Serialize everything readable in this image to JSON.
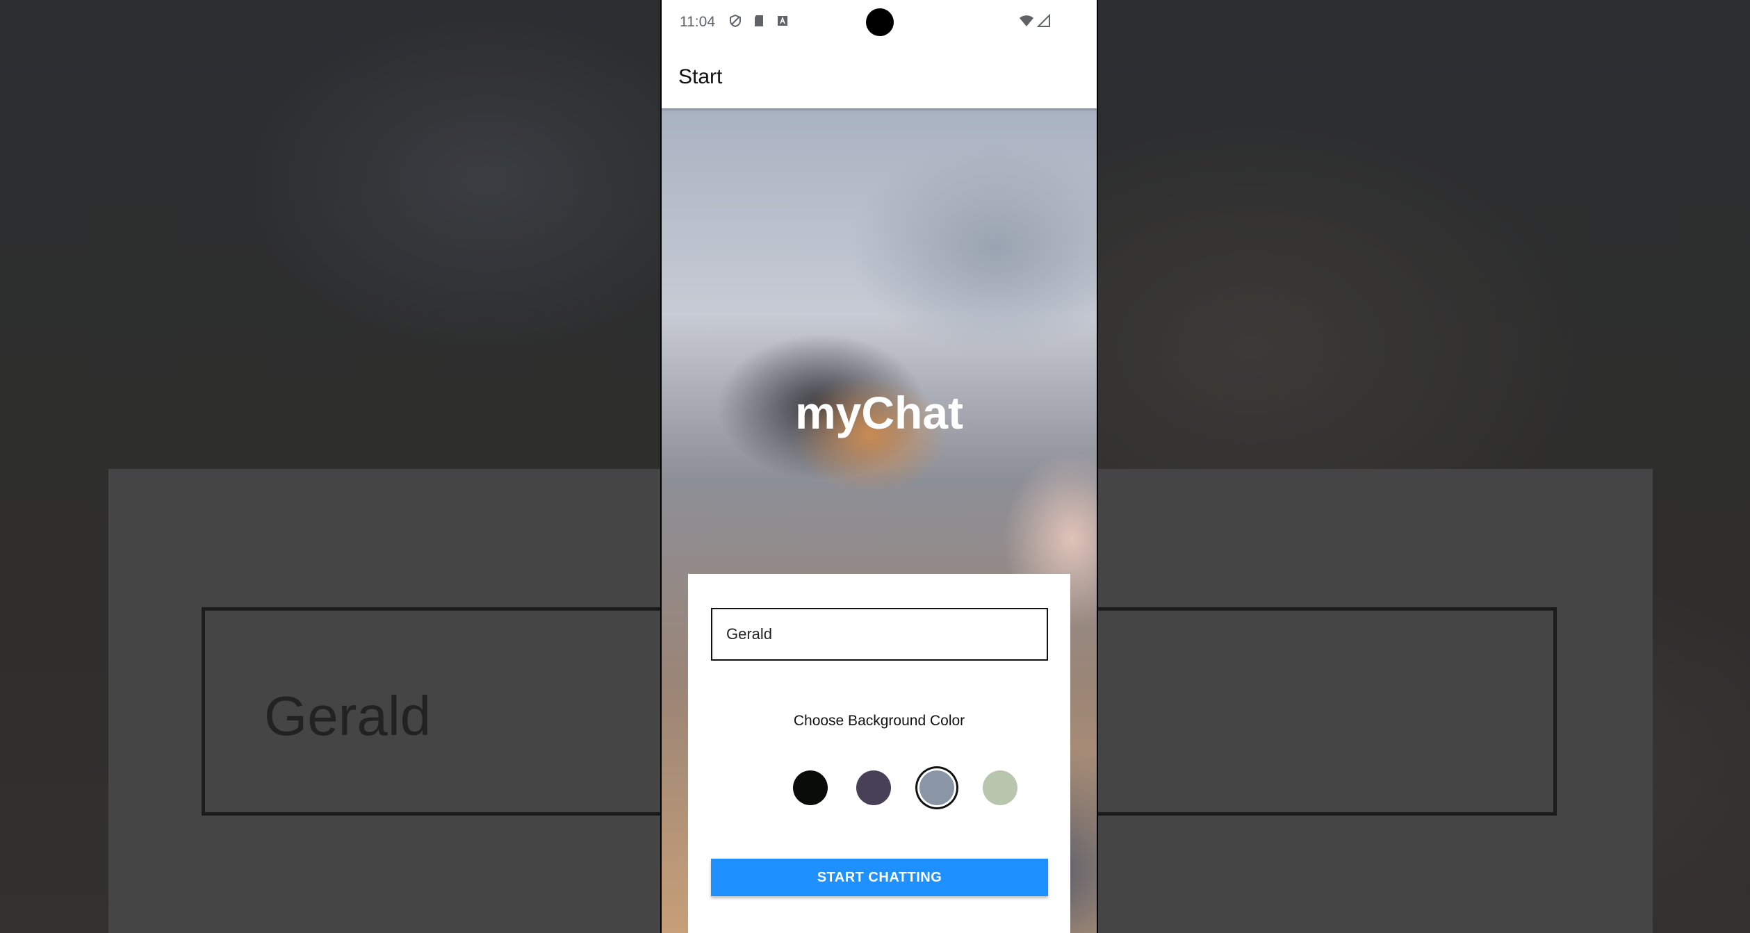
{
  "status_bar": {
    "time": "11:04",
    "icons": [
      "shield-icon",
      "sd-card-icon",
      "text-a-icon"
    ],
    "right_icons": [
      "wifi-icon",
      "cell-signal-icon"
    ]
  },
  "app_bar": {
    "title": "Start"
  },
  "hero": {
    "app_name": "myChat"
  },
  "form": {
    "name_value": "Gerald",
    "color_label": "Choose Background Color",
    "colors": [
      {
        "name": "black",
        "hex": "#090C08",
        "selected": false
      },
      {
        "name": "purple",
        "hex": "#474056",
        "selected": false
      },
      {
        "name": "gray-blue",
        "hex": "#8A95A5",
        "selected": true
      },
      {
        "name": "green",
        "hex": "#B9C6AE",
        "selected": false
      }
    ],
    "start_button": "START CHATTING"
  },
  "backdrop": {
    "name_value": "Gerald"
  }
}
